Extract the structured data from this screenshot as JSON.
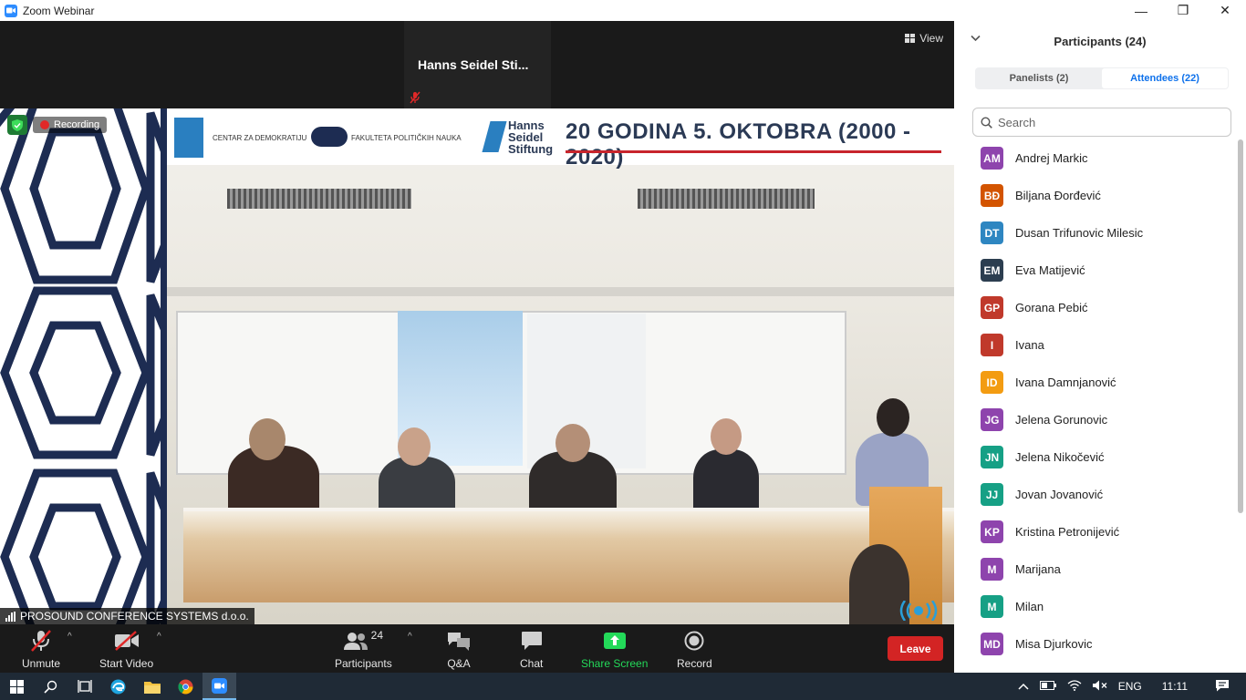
{
  "window": {
    "title": "Zoom Webinar",
    "minimize": "—",
    "maximize": "❐",
    "close": "✕"
  },
  "stage": {
    "speaker_name": "Hanns Seidel Sti...",
    "view_label": "View",
    "recording_label": "Recording",
    "caption": "PROSOUND CONFERENCE SYSTEMS d.o.o."
  },
  "banner": {
    "title": "20 GODINA 5. OKTOBRA (2000 - 2020)",
    "org1": "CENTAR ZA DEMOKRATIJU",
    "org2": "FAKULTETA POLITIČKIH NAUKA",
    "org3": "Hanns Seidel Stiftung",
    "fpn": "ФПН"
  },
  "toolbar": {
    "unmute": "Unmute",
    "start_video": "Start Video",
    "participants": "Participants",
    "participants_count": "24",
    "qa": "Q&A",
    "chat": "Chat",
    "share_screen": "Share Screen",
    "record": "Record",
    "leave": "Leave"
  },
  "panel": {
    "title": "Participants (24)",
    "tabs": [
      {
        "label": "Panelists (2)",
        "active": false
      },
      {
        "label": "Attendees (22)",
        "active": true
      }
    ],
    "search_placeholder": "Search",
    "participants": [
      {
        "initials": "AM",
        "name": "Andrej Markic",
        "color": "#8e44ad"
      },
      {
        "initials": "BĐ",
        "name": "Biljana Đorđević",
        "color": "#d35400"
      },
      {
        "initials": "DT",
        "name": "Dusan Trifunovic Milesic",
        "color": "#2e86c1"
      },
      {
        "initials": "EM",
        "name": "Eva Matijević",
        "color": "#2c3e50"
      },
      {
        "initials": "GP",
        "name": "Gorana Pebić",
        "color": "#c0392b"
      },
      {
        "initials": "I",
        "name": "Ivana",
        "color": "#c0392b"
      },
      {
        "initials": "ID",
        "name": "Ivana Damnjanović",
        "color": "#f39c12"
      },
      {
        "initials": "JG",
        "name": "Jelena Gorunovic",
        "color": "#8e44ad"
      },
      {
        "initials": "JN",
        "name": "Jelena Nikočević",
        "color": "#16a085"
      },
      {
        "initials": "JJ",
        "name": "Jovan Jovanović",
        "color": "#16a085"
      },
      {
        "initials": "KP",
        "name": "Kristina Petronijević",
        "color": "#8e44ad"
      },
      {
        "initials": "M",
        "name": "Marijana",
        "color": "#8e44ad"
      },
      {
        "initials": "M",
        "name": "Milan",
        "color": "#16a085"
      },
      {
        "initials": "MD",
        "name": "Misa Djurkovic",
        "color": "#8e44ad"
      }
    ]
  },
  "taskbar": {
    "lang": "ENG",
    "time": "11:11"
  },
  "colors": {
    "accent": "#0e71eb",
    "leave": "#d32424",
    "share": "#23d959",
    "recording": "#e02828"
  }
}
